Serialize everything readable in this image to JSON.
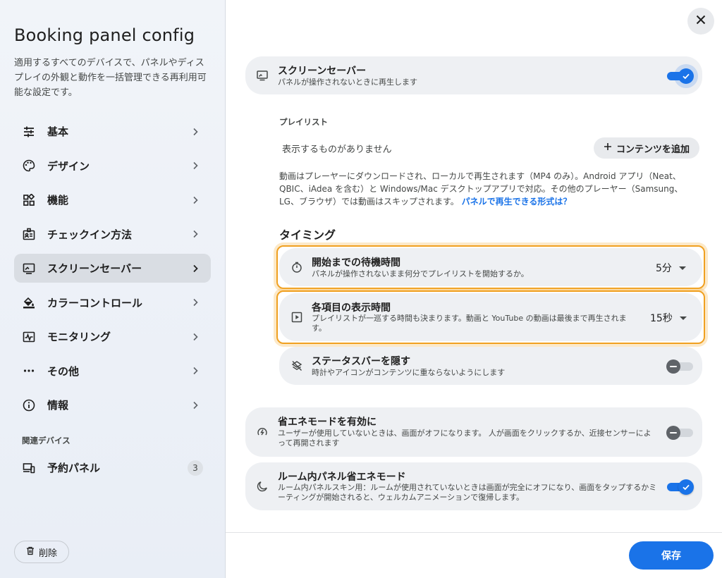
{
  "sidebar": {
    "title": "Booking panel config",
    "description": "適用するすべてのデバイスで、パネルやディスプレイの外観と動作を一括管理できる再利用可能な設定です。",
    "items": [
      {
        "label": "基本",
        "icon": "tune-icon"
      },
      {
        "label": "デザイン",
        "icon": "palette-icon"
      },
      {
        "label": "機能",
        "icon": "widgets-icon"
      },
      {
        "label": "チェックイン方法",
        "icon": "badge-icon"
      },
      {
        "label": "スクリーンセーバー",
        "icon": "monitor-icon",
        "active": true
      },
      {
        "label": "カラーコントロール",
        "icon": "paint-bucket-icon"
      },
      {
        "label": "モニタリング",
        "icon": "monitoring-icon"
      },
      {
        "label": "その他",
        "icon": "more-icon"
      },
      {
        "label": "情報",
        "icon": "info-icon"
      }
    ],
    "related_section": "関連デバイス",
    "related_item": {
      "label": "予約パネル",
      "count": "3",
      "icon": "devices-icon"
    },
    "delete_label": "削除"
  },
  "main": {
    "screensaver": {
      "title": "スクリーンセーバー",
      "subtitle": "パネルが操作されないときに再生します",
      "enabled": true
    },
    "playlist": {
      "label": "プレイリスト",
      "empty_text": "表示するものがありません",
      "add_label": "コンテンツを追加"
    },
    "info_text": "動画はプレーヤーにダウンロードされ、ローカルで再生されます（MP4 のみ）。Android アプリ（Neat、QBIC、iAdea を含む）と Windows/Mac デスクトップアプリで対応。その他のプレーヤー（Samsung、LG、ブラウザ）では動画はスキップされます。",
    "info_link": "パネルで再生できる形式は？",
    "timing_heading": "タイミング",
    "wait_time": {
      "title": "開始までの待機時間",
      "subtitle": "パネルが操作されないまま何分でプレイリストを開始するか。",
      "value": "5分"
    },
    "item_duration": {
      "title": "各項目の表示時間",
      "subtitle": "プレイリストが一巡する時間も決まります。動画と YouTube の動画は最後まで再生されます。",
      "value": "15秒"
    },
    "hide_statusbar": {
      "title": "ステータスバーを隠す",
      "subtitle": "時計やアイコンがコンテンツに重ならないようにします",
      "enabled": false
    },
    "power_save": {
      "title": "省エネモードを有効に",
      "subtitle": "ユーザーが使用していないときは、画面がオフになります。 人が画面をクリックするか、近接センサーによって再開されます",
      "enabled": false
    },
    "room_power_save": {
      "title": "ルーム内パネル省エネモード",
      "subtitle": "ルーム内パネルスキン用：ルームが使用されていないときは画面が完全にオフになり、画面をタップするかミーティングが開始されると、ウェルカムアニメーションで復帰します。",
      "enabled": true
    },
    "save_label": "保存"
  },
  "colors": {
    "accent": "#1a73e8",
    "highlight": "#f0a020",
    "card": "#eef0f3"
  }
}
